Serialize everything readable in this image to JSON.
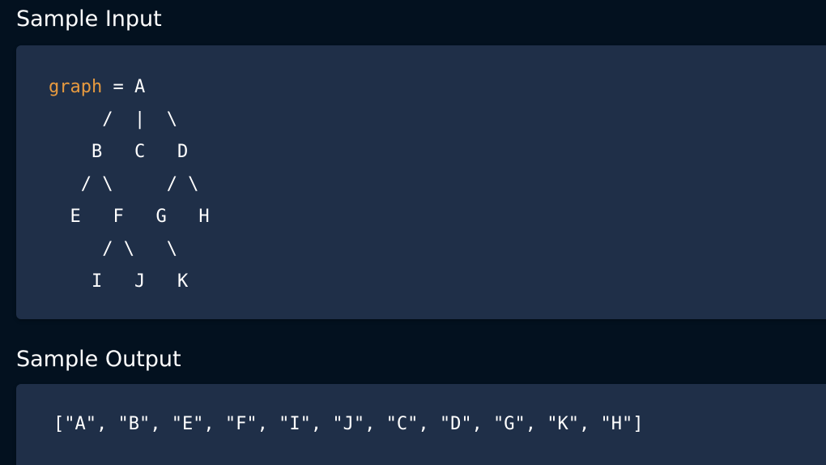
{
  "input_section": {
    "title": "Sample Input",
    "code": {
      "keyword": "graph",
      "first_line_rest": " = A",
      "tree_lines": "     /  |  \\\n    B   C   D\n   / \\     / \\\n  E   F   G   H\n     / \\   \\\n    I   J   K"
    }
  },
  "output_section": {
    "title": "Sample Output",
    "code": "[\"A\", \"B\", \"E\", \"F\", \"I\", \"J\", \"C\", \"D\", \"G\", \"K\", \"H\"]"
  },
  "colors": {
    "page_background": "#03111f",
    "panel_background": "#1f2f48",
    "keyword": "#e79a3f",
    "text": "#ffffff"
  }
}
